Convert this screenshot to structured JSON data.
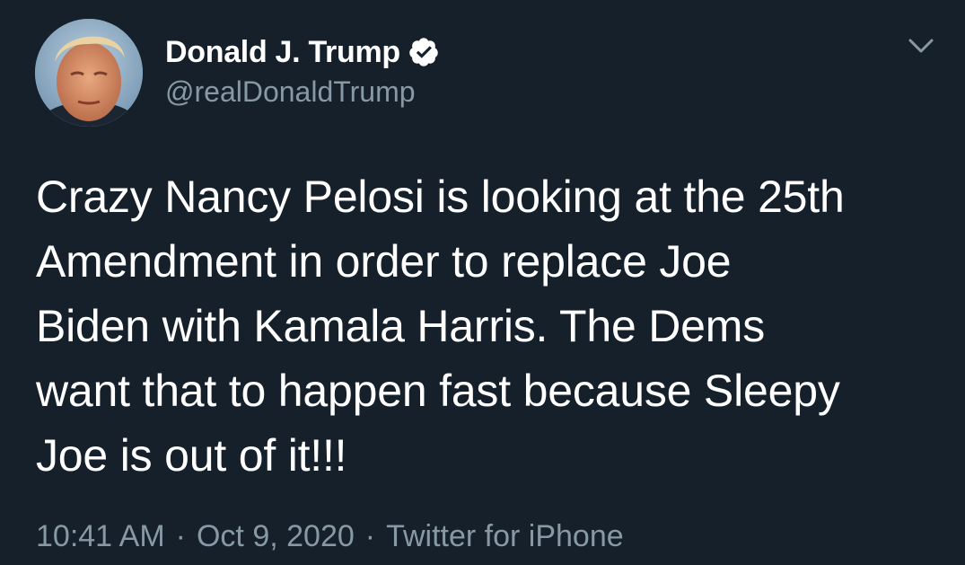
{
  "tweet": {
    "author": {
      "display_name": "Donald J. Trump",
      "handle": "@realDonaldTrump",
      "verified": true
    },
    "text": "Crazy Nancy Pelosi is looking at the 25th\nAmendment in order to replace Joe\nBiden with Kamala Harris. The Dems\nwant that to happen fast because Sleepy\nJoe is out of it!!!",
    "time": "10:41 AM",
    "date": "Oct 9, 2020",
    "separator": "·",
    "source": "Twitter for iPhone"
  },
  "icons": {
    "verified": "verified-badge-icon",
    "menu": "chevron-down-icon"
  },
  "colors": {
    "background": "#15202b",
    "primary_text": "#ffffff",
    "secondary_text": "#8899a6"
  }
}
